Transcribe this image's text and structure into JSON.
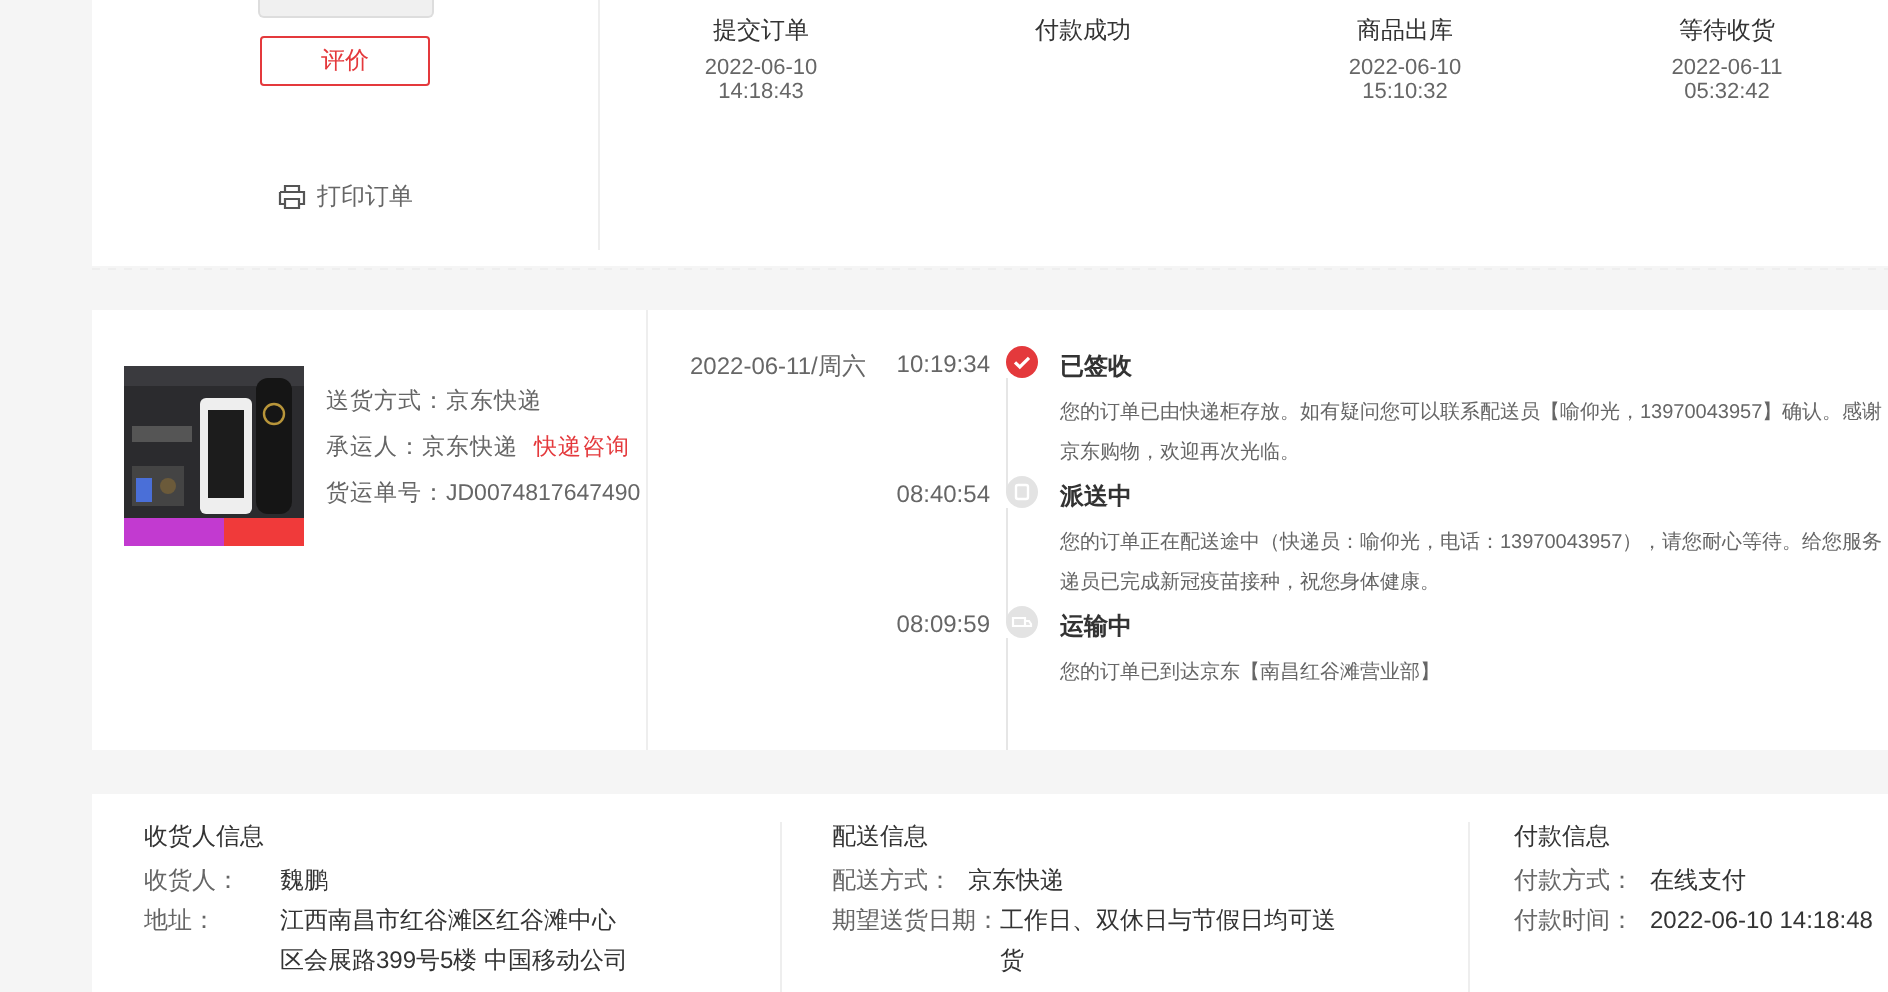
{
  "order_actions": {
    "review_button": "评价",
    "print_link": "打印订单"
  },
  "progress_steps": [
    {
      "label": "提交订单",
      "date": "2022-06-10",
      "time": "14:18:43"
    },
    {
      "label": "付款成功"
    },
    {
      "label": "商品出库",
      "date": "2022-06-10",
      "time": "15:10:32"
    },
    {
      "label": "等待收货",
      "date": "2022-06-11",
      "time": "05:32:42"
    }
  ],
  "shipment": {
    "fields": [
      {
        "label": "送货方式：",
        "value": "京东快递"
      },
      {
        "label": "承运人：",
        "value": "京东快递",
        "link": "快递咨询"
      },
      {
        "label": "货运单号：",
        "value": "JD0074817647490"
      }
    ]
  },
  "tracking": [
    {
      "date": "2022-06-11/周六",
      "time": "10:19:34",
      "kind": "signed",
      "title": "已签收",
      "lines": [
        "您的订单已由快递柜存放。如有疑问您可以联系配送员【喻仰光，13970043957】确认。感谢",
        "京东购物，欢迎再次光临。"
      ]
    },
    {
      "time": "08:40:54",
      "kind": "delivering",
      "title": "派送中",
      "lines": [
        "您的订单正在配送途中（快递员：喻仰光，电话：13970043957），请您耐心等待。给您服务",
        "递员已完成新冠疫苗接种，祝您身体健康。"
      ]
    },
    {
      "time": "08:09:59",
      "kind": "transit",
      "title": "运输中",
      "lines": [
        "您的订单已到达京东【南昌红谷滩营业部】"
      ]
    }
  ],
  "info_sections": [
    {
      "title": "收货人信息",
      "rows": [
        {
          "label": "收货人：",
          "value": [
            "魏鹏"
          ]
        },
        {
          "label": "地址：",
          "value": [
            "江西南昌市红谷滩区红谷滩中心",
            "区会展路399号5楼 中国移动公司"
          ]
        }
      ]
    },
    {
      "title": "配送信息",
      "rows": [
        {
          "label": "配送方式：",
          "value": [
            "京东快递"
          ]
        },
        {
          "label": "期望送货日期：",
          "value": [
            "工作日、双休日与节假日均可送",
            "货"
          ]
        }
      ]
    },
    {
      "title": "付款信息",
      "rows": [
        {
          "label": "付款方式：",
          "value": [
            "在线支付"
          ]
        },
        {
          "label": "付款时间：",
          "value": [
            "2022-06-10 14:18:48"
          ]
        }
      ]
    }
  ]
}
